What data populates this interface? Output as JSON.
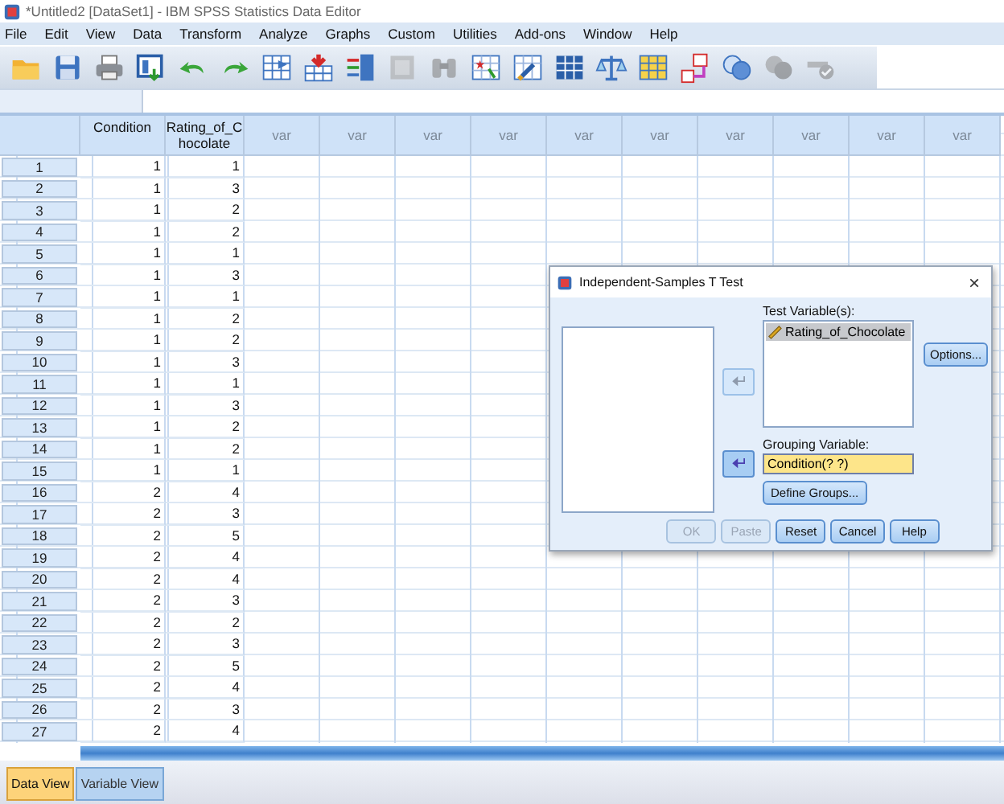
{
  "window": {
    "title": "*Untitled2 [DataSet1] - IBM SPSS Statistics Data Editor"
  },
  "menu": [
    "File",
    "Edit",
    "View",
    "Data",
    "Transform",
    "Analyze",
    "Graphs",
    "Custom",
    "Utilities",
    "Add-ons",
    "Window",
    "Help"
  ],
  "toolbar": [
    {
      "kind": "open",
      "disabled": false
    },
    {
      "kind": "save",
      "disabled": false
    },
    {
      "kind": "print",
      "disabled": false
    },
    {
      "kind": "recall",
      "disabled": false
    },
    {
      "kind": "undo",
      "disabled": false
    },
    {
      "kind": "redo",
      "disabled": false
    },
    {
      "kind": "goto-case",
      "disabled": false
    },
    {
      "kind": "goto-variable",
      "disabled": false
    },
    {
      "kind": "variables",
      "disabled": false
    },
    {
      "kind": "chart",
      "disabled": true
    },
    {
      "kind": "find",
      "disabled": true
    },
    {
      "kind": "insert-cases",
      "disabled": false
    },
    {
      "kind": "insert-variable",
      "disabled": false
    },
    {
      "kind": "split",
      "disabled": false
    },
    {
      "kind": "weight",
      "disabled": false
    },
    {
      "kind": "select",
      "disabled": false
    },
    {
      "kind": "value-labels",
      "disabled": false
    },
    {
      "kind": "sets",
      "disabled": false
    },
    {
      "kind": "show-sets",
      "disabled": true
    },
    {
      "kind": "spell",
      "disabled": true
    }
  ],
  "grid": {
    "columns": [
      {
        "label": "Condition",
        "empty": false
      },
      {
        "label": "Rating_of_Chocolate",
        "empty": false
      },
      {
        "label": "var",
        "empty": true
      },
      {
        "label": "var",
        "empty": true
      },
      {
        "label": "var",
        "empty": true
      },
      {
        "label": "var",
        "empty": true
      },
      {
        "label": "var",
        "empty": true
      },
      {
        "label": "var",
        "empty": true
      },
      {
        "label": "var",
        "empty": true
      },
      {
        "label": "var",
        "empty": true
      },
      {
        "label": "var",
        "empty": true
      },
      {
        "label": "var",
        "empty": true
      }
    ],
    "rows": [
      {
        "header": "1",
        "cells": [
          "1",
          "1"
        ]
      },
      {
        "header": "2",
        "cells": [
          "1",
          "3"
        ]
      },
      {
        "header": "3",
        "cells": [
          "1",
          "2"
        ]
      },
      {
        "header": "4",
        "cells": [
          "1",
          "2"
        ]
      },
      {
        "header": "5",
        "cells": [
          "1",
          "1"
        ]
      },
      {
        "header": "6",
        "cells": [
          "1",
          "3"
        ]
      },
      {
        "header": "7",
        "cells": [
          "1",
          "1"
        ]
      },
      {
        "header": "8",
        "cells": [
          "1",
          "2"
        ]
      },
      {
        "header": "9",
        "cells": [
          "1",
          "2"
        ]
      },
      {
        "header": "10",
        "cells": [
          "1",
          "3"
        ]
      },
      {
        "header": "11",
        "cells": [
          "1",
          "1"
        ]
      },
      {
        "header": "12",
        "cells": [
          "1",
          "3"
        ]
      },
      {
        "header": "13",
        "cells": [
          "1",
          "2"
        ]
      },
      {
        "header": "14",
        "cells": [
          "1",
          "2"
        ]
      },
      {
        "header": "15",
        "cells": [
          "1",
          "1"
        ]
      },
      {
        "header": "16",
        "cells": [
          "2",
          "4"
        ]
      },
      {
        "header": "17",
        "cells": [
          "2",
          "3"
        ]
      },
      {
        "header": "18",
        "cells": [
          "2",
          "5"
        ]
      },
      {
        "header": "19",
        "cells": [
          "2",
          "4"
        ]
      },
      {
        "header": "20",
        "cells": [
          "2",
          "4"
        ]
      },
      {
        "header": "21",
        "cells": [
          "2",
          "3"
        ]
      },
      {
        "header": "22",
        "cells": [
          "2",
          "2"
        ]
      },
      {
        "header": "23",
        "cells": [
          "2",
          "3"
        ]
      },
      {
        "header": "24",
        "cells": [
          "2",
          "5"
        ]
      },
      {
        "header": "25",
        "cells": [
          "2",
          "4"
        ]
      },
      {
        "header": "26",
        "cells": [
          "2",
          "3"
        ]
      },
      {
        "header": "27",
        "cells": [
          "2",
          "4"
        ]
      }
    ]
  },
  "dialog": {
    "title": "Independent-Samples T Test",
    "close": "×",
    "test_variables_label": "Test Variable(s):",
    "test_variables": [
      {
        "label": "Rating_of_Chocolate",
        "selected": true
      }
    ],
    "move_buttons": [
      {
        "disabled": true
      },
      {
        "disabled": false
      }
    ],
    "grouping_label": "Grouping Variable:",
    "grouping_value": "Condition(? ?)",
    "options_button": {
      "label": "Options...",
      "disabled": false
    },
    "define_groups_button": {
      "label": "Define Groups...",
      "disabled": false
    },
    "buttons": [
      {
        "label": "OK",
        "disabled": true
      },
      {
        "label": "Paste",
        "disabled": true
      },
      {
        "label": "Reset",
        "disabled": false
      },
      {
        "label": "Cancel",
        "disabled": false
      },
      {
        "label": "Help",
        "disabled": false
      }
    ]
  },
  "view_tabs": [
    {
      "label": "Data View",
      "selected": true
    },
    {
      "label": "Variable View",
      "selected": false
    }
  ]
}
